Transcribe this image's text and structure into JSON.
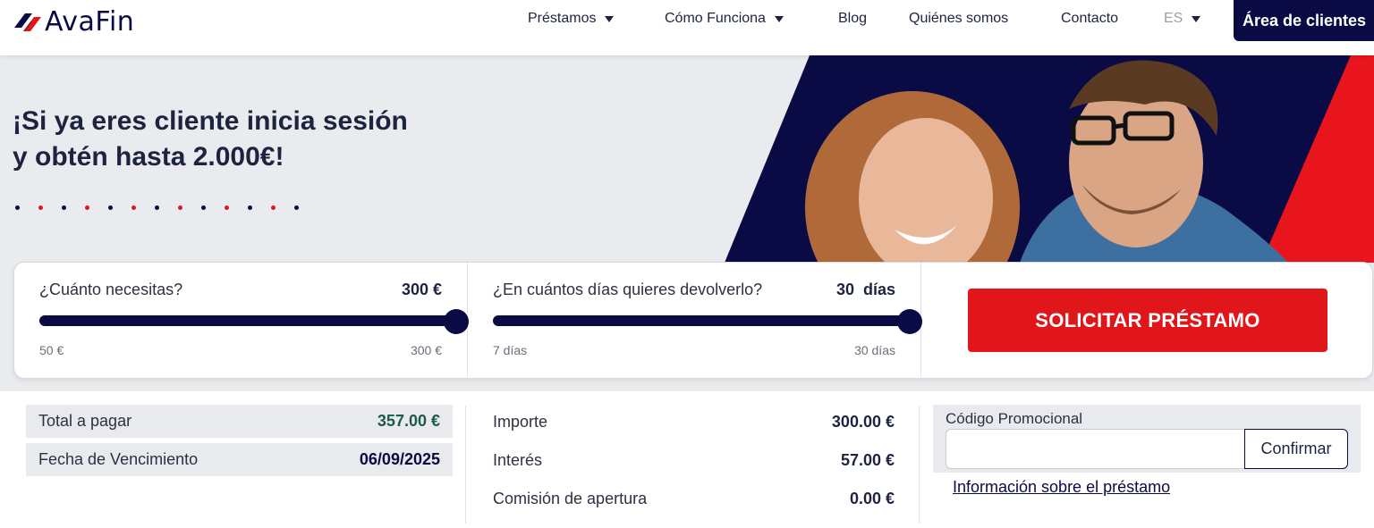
{
  "brand": {
    "name": "AvaFin",
    "primary": "#0a0a45",
    "accent": "#e0161b"
  },
  "nav": {
    "items": [
      {
        "label": "Préstamos",
        "dropdown": true
      },
      {
        "label": "Cómo Funciona",
        "dropdown": true
      },
      {
        "label": "Blog",
        "dropdown": false
      },
      {
        "label": "Quiénes somos",
        "dropdown": false
      },
      {
        "label": "Contacto",
        "dropdown": false
      }
    ],
    "language": "ES",
    "client_area": "Área de clientes"
  },
  "hero": {
    "title_line1": "¡Si ya eres cliente inicia sesión",
    "title_line2": "y obtén hasta 2.000€!",
    "dot_colors": [
      "#0a0a45",
      "#e0161b",
      "#0a0a45",
      "#e0161b",
      "#0a0a45",
      "#e0161b",
      "#0a0a45",
      "#e0161b",
      "#0a0a45",
      "#e0161b",
      "#0a0a45",
      "#e0161b",
      "#0a0a45"
    ]
  },
  "calculator": {
    "amount": {
      "question": "¿Cuánto necesitas?",
      "value": "300 €",
      "min": "50 €",
      "max": "300 €",
      "fraction": 1.0
    },
    "days": {
      "question": "¿En cuántos días quieres devolverlo?",
      "value": "30  días",
      "min": "7 días",
      "max": "30 días",
      "fraction": 1.0
    },
    "apply_label": "SOLICITAR PRÉSTAMO"
  },
  "summary": {
    "total_label": "Total a pagar",
    "total_value": "357.00 €",
    "due_label": "Fecha de Vencimiento",
    "due_value": "06/09/2025",
    "importe_label": "Importe",
    "importe_value": "300.00 €",
    "interes_label": "Interés",
    "interes_value": "57.00 €",
    "comision_label": "Comisión de apertura",
    "comision_value": "0.00 €"
  },
  "promo": {
    "label": "Código Promocional",
    "input_value": "",
    "confirm_label": "Confirmar",
    "info_link": "Información sobre el préstamo"
  }
}
